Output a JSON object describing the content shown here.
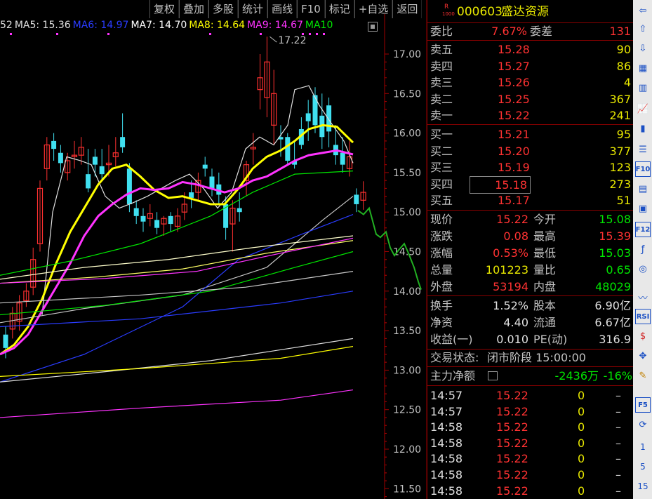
{
  "toolbar": [
    "复权",
    "叠加",
    "多股",
    "统计",
    "画线",
    "F10",
    "标记",
    "+自选",
    "返回"
  ],
  "ma_legend": [
    {
      "text": "52",
      "color": "#e0e0e0"
    },
    {
      "text": "MA5: 15.36",
      "color": "#e0e0e0"
    },
    {
      "text": "MA6: 14.97",
      "color": "#2a3cff"
    },
    {
      "text": "MA7: 14.70",
      "color": "#ffffff"
    },
    {
      "text": "MA8: 14.64",
      "color": "#ffff00"
    },
    {
      "text": "MA9: 14.67",
      "color": "#ff33ff"
    },
    {
      "text": "MA10",
      "color": "#00e600"
    }
  ],
  "chart": {
    "high_annotation": "17.22",
    "y_ticks": [
      "17.00",
      "16.50",
      "16.00",
      "15.50",
      "15.00",
      "14.50",
      "14.00",
      "13.50",
      "13.00",
      "12.50",
      "12.00",
      "11.50"
    ],
    "colors": {
      "up": "#ff3030",
      "down": "#40e0f0",
      "axis": "#a00000"
    }
  },
  "stock": {
    "badge_top": "R",
    "badge_bottom": "1000",
    "code": "000603",
    "name": "盛达资源"
  },
  "weibi": {
    "label": "委比",
    "value": "7.67%",
    "label2": "委差",
    "value2": "131"
  },
  "asks": [
    {
      "label": "卖五",
      "price": "15.28",
      "vol": "90"
    },
    {
      "label": "卖四",
      "price": "15.27",
      "vol": "86"
    },
    {
      "label": "卖三",
      "price": "15.26",
      "vol": "4"
    },
    {
      "label": "卖二",
      "price": "15.25",
      "vol": "367"
    },
    {
      "label": "卖一",
      "price": "15.22",
      "vol": "241"
    }
  ],
  "bids": [
    {
      "label": "买一",
      "price": "15.21",
      "vol": "95"
    },
    {
      "label": "买二",
      "price": "15.20",
      "vol": "377"
    },
    {
      "label": "买三",
      "price": "15.19",
      "vol": "123"
    },
    {
      "label": "买四",
      "price": "15.18",
      "vol": "273"
    },
    {
      "label": "买五",
      "price": "15.17",
      "vol": "51"
    }
  ],
  "stats": [
    {
      "l1": "现价",
      "v1": "15.22",
      "c1": "red",
      "l2": "今开",
      "v2": "15.08",
      "c2": "grn"
    },
    {
      "l1": "涨跌",
      "v1": "0.08",
      "c1": "red",
      "l2": "最高",
      "v2": "15.39",
      "c2": "red"
    },
    {
      "l1": "涨幅",
      "v1": "0.53%",
      "c1": "red",
      "l2": "最低",
      "v2": "15.03",
      "c2": "grn"
    },
    {
      "l1": "总量",
      "v1": "101223",
      "c1": "yel",
      "l2": "量比",
      "v2": "0.65",
      "c2": "grn"
    },
    {
      "l1": "外盘",
      "v1": "53194",
      "c1": "red",
      "l2": "内盘",
      "v2": "48029",
      "c2": "grn"
    }
  ],
  "fundamentals": [
    {
      "l1": "换手",
      "v1": "1.52%",
      "l2": "股本",
      "v2": "6.90亿"
    },
    {
      "l1": "净资",
      "v1": "4.40",
      "l2": "流通",
      "v2": "6.67亿"
    },
    {
      "l1": "收益(一)",
      "v1": "0.010",
      "l2": "PE(动)",
      "v2": "316.9"
    }
  ],
  "status": {
    "label": "交易状态:",
    "value": "闭市阶段 15:00:00"
  },
  "fund_flow": {
    "label": "主力净额",
    "value": "-2436万",
    "pct": "-16%"
  },
  "ticks": [
    {
      "time": "14:57",
      "price": "15.22",
      "vol": "0",
      "flag": "–"
    },
    {
      "time": "14:57",
      "price": "15.22",
      "vol": "0",
      "flag": "–"
    },
    {
      "time": "14:58",
      "price": "15.22",
      "vol": "0",
      "flag": "–"
    },
    {
      "time": "14:58",
      "price": "15.22",
      "vol": "0",
      "flag": "–"
    },
    {
      "time": "14:58",
      "price": "15.22",
      "vol": "0",
      "flag": "–"
    },
    {
      "time": "14:58",
      "price": "15.22",
      "vol": "0",
      "flag": "–"
    },
    {
      "time": "14:58",
      "price": "15.22",
      "vol": "0",
      "flag": "–"
    }
  ],
  "side_tools": [
    "home-icon",
    "arrow-up-icon",
    "arrow-down-icon",
    "chart-icon",
    "grid-icon",
    "line-chart-icon",
    "candle-icon",
    "list-icon",
    "f10-icon",
    "news-icon",
    "self-select-icon",
    "f12-icon",
    "formula-icon",
    "circle-icon",
    "trend-icon",
    "rsi-icon",
    "dollar-icon",
    "move-icon",
    "pencil-icon",
    "f5-icon",
    "refresh-icon"
  ],
  "side_labels": {
    "rsi": "RSI",
    "f10": "F10",
    "f12": "F12",
    "f5": "F5",
    "n1": "1",
    "n5": "5",
    "n15": "15"
  }
}
